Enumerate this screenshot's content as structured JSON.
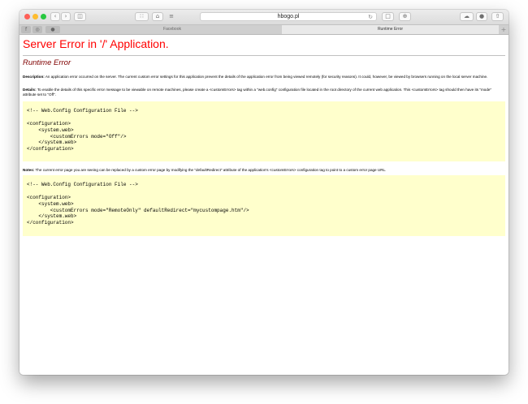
{
  "browser": {
    "address": "hbogo.pl",
    "tabs": [
      {
        "label": "Facebook",
        "active": false
      },
      {
        "label": "Runtime Error",
        "active": true
      }
    ],
    "new_tab_label": "+"
  },
  "page": {
    "heading": "Server Error in '/' Application.",
    "subheading": "Runtime Error",
    "description_label": "Description:",
    "description_text": "An application error occurred on the server. The current custom error settings for this application prevent the details of the application error from being viewed remotely (for security reasons). It could, however, be viewed by browsers running on the local server machine.",
    "details_label": "Details:",
    "details_text": "To enable the details of this specific error message to be viewable on remote machines, please create a <customErrors> tag within a \"web.config\" configuration file located in the root directory of the current web application. This <customErrors> tag should then have its \"mode\" attribute set to \"Off\".",
    "code1": "\n<!-- Web.Config Configuration File -->\n\n<configuration>\n    <system.web>\n        <customErrors mode=\"Off\"/>\n    </system.web>\n</configuration>\n",
    "notes_label": "Notes:",
    "notes_text": "The current error page you are seeing can be replaced by a custom error page by modifying the \"defaultRedirect\" attribute of the application's <customErrors> configuration tag to point to a custom error page URL.",
    "code2": "\n<!-- Web.Config Configuration File -->\n\n<configuration>\n    <system.web>\n        <customErrors mode=\"RemoteOnly\" defaultRedirect=\"mycustompage.htm\"/>\n    </system.web>\n</configuration>\n"
  },
  "colors": {
    "heading": "#ff0000",
    "subheading": "#800000",
    "code_background": "#ffffcc",
    "close": "#fe5f57",
    "minimize": "#febc2e",
    "zoom": "#28c840"
  },
  "icons": [
    "back-arrow-icon",
    "forward-arrow-icon",
    "sidebar-icon",
    "tabs-grid-icon",
    "home-icon",
    "reader-icon",
    "reload-icon",
    "share-icon",
    "history-icon",
    "cloud-icon",
    "shield-icon",
    "upload-icon",
    "facebook-icon",
    "instagram-icon"
  ]
}
